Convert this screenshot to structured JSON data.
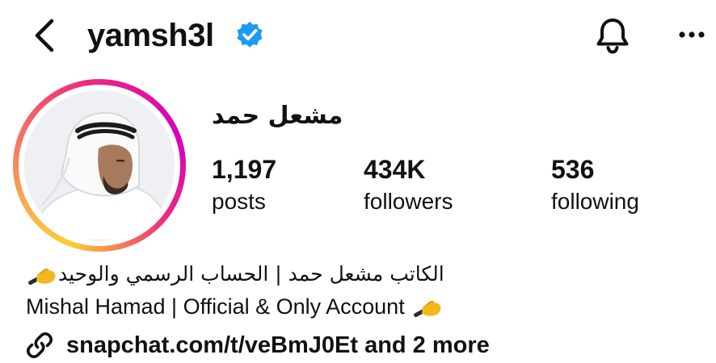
{
  "header": {
    "username": "yamsh3l",
    "verified_icon": "verified-badge-icon",
    "back_icon": "chevron-left-icon",
    "bell_icon": "bell-icon",
    "more_icon": "more-horizontal-icon"
  },
  "profile": {
    "display_name": "مشعل حمد",
    "avatar_icon": "profile-avatar",
    "stats": [
      {
        "value": "1,197",
        "label": "posts"
      },
      {
        "value": "434K",
        "label": "followers"
      },
      {
        "value": "536",
        "label": "following"
      }
    ]
  },
  "bio": {
    "line1": "الكاتب مشعل حمد | الحساب الرسمي والوحيد",
    "line2": "Mishal Hamad | Official & Only Account",
    "emoji_icon": "writing-hand-emoji",
    "link_icon": "link-icon",
    "link_text": "snapchat.com/t/veBmJ0Et and 2 more"
  },
  "colors": {
    "verified_blue": "#1d9bf0",
    "ring_pink": "#ee2a7b",
    "ring_orange": "#fbad50",
    "ring_yellow": "#f9ce34",
    "ring_purple": "#d300c5"
  }
}
